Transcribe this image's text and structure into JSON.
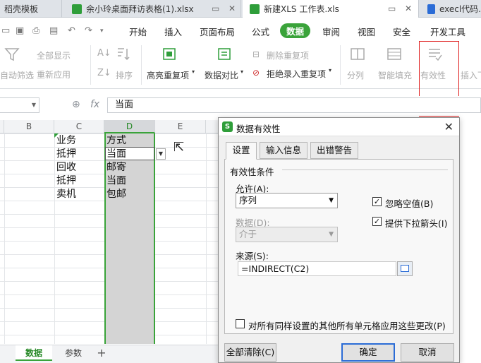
{
  "tabs": [
    {
      "label": "稻壳模板"
    },
    {
      "label": "余小玲桌面拜访表格(1).xlsx"
    },
    {
      "label": "新建XLS 工作表.xls"
    },
    {
      "label": "execl代码."
    }
  ],
  "menu": [
    "开始",
    "插入",
    "页面布局",
    "公式",
    "数据",
    "审阅",
    "视图",
    "安全",
    "开发工具"
  ],
  "menu_active": "数据",
  "tools": {
    "auto_filter": "自动筛选",
    "show_all": "全部显示",
    "reapply": "重新应用",
    "sort": "排序",
    "highlight_dup": "高亮重复项",
    "data_compare": "数据对比",
    "delete_dup": "删除重复项",
    "reject_dup": "拒绝录入重复项",
    "split": "分列",
    "smart_fill": "智能填充",
    "validity": "有效性",
    "insert_dropdown": "插入下"
  },
  "formula_bar": {
    "fx": "fx",
    "value": "当面"
  },
  "columns": [
    "B",
    "C",
    "D",
    "E"
  ],
  "cells": {
    "c": [
      "业务",
      "抵押",
      "回收",
      "抵押",
      "卖机"
    ],
    "d": [
      "方式",
      "当面",
      "邮寄",
      "当面",
      "包邮"
    ]
  },
  "sheets": {
    "active": "数据",
    "other": "参数",
    "add": "+"
  },
  "dialog": {
    "title": "数据有效性",
    "close": "✕",
    "tabs": [
      "设置",
      "输入信息",
      "出错警告"
    ],
    "group_title": "有效性条件",
    "allow_label": "允许(A):",
    "allow_value": "序列",
    "data_label": "数据(D):",
    "data_value": "介于",
    "ignore_blank": "忽略空值(B)",
    "dropdown_arrow": "提供下拉箭头(I)",
    "source_label": "来源(S):",
    "source_value": "=INDIRECT(C2)",
    "apply_all": "对所有同样设置的其他所有单元格应用这些更改(P)",
    "clear_all": "全部清除(C)",
    "ok": "确定",
    "cancel": "取消"
  }
}
